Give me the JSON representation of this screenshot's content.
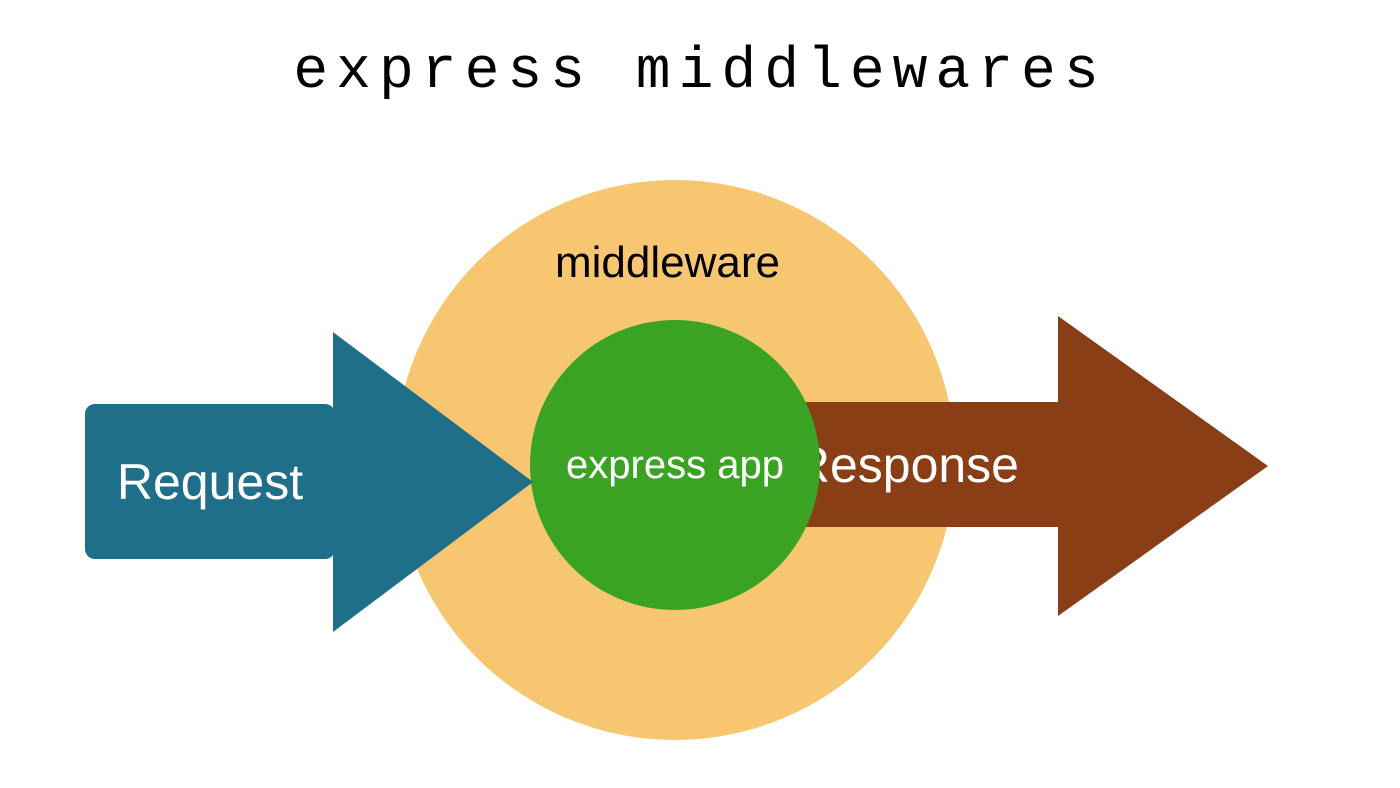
{
  "title": "express middlewares",
  "labels": {
    "middleware": "middleware",
    "express_app": "express app",
    "request": "Request",
    "response": "Response"
  },
  "colors": {
    "outer_circle": "#f7c670",
    "inner_circle": "#3aa324",
    "request_arrow": "#1f6f8b",
    "response_arrow": "#8a3e16",
    "title_text": "#000000",
    "label_text_light": "#ffffff"
  }
}
